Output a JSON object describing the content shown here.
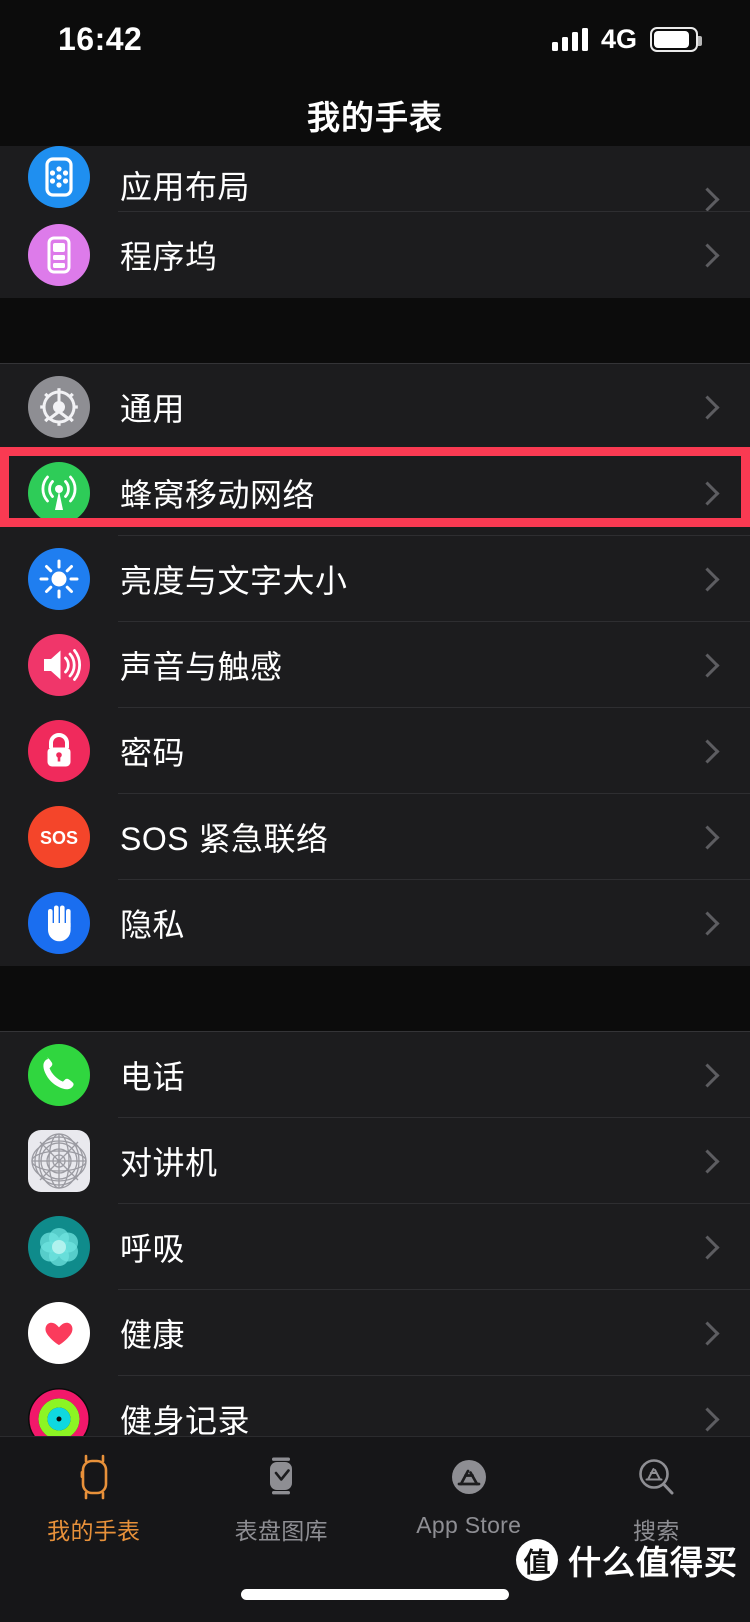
{
  "status_bar": {
    "time": "16:42",
    "network": "4G",
    "signal_bars": 4,
    "battery_level": "88%"
  },
  "nav": {
    "title": "我的手表"
  },
  "sections": [
    {
      "id": "section-apps",
      "rows": [
        {
          "label": "应用布局",
          "icon": "app-layout-icon",
          "color": "#1f8ff0",
          "clipped": true
        },
        {
          "label": "程序坞",
          "icon": "dock-icon",
          "color": "#dd7bea"
        }
      ]
    },
    {
      "id": "section-system",
      "rows": [
        {
          "label": "通用",
          "icon": "gear-icon",
          "color": "#8e8e93"
        },
        {
          "label": "蜂窝移动网络",
          "icon": "cellular-icon",
          "color": "#2ecc58",
          "highlighted": true
        },
        {
          "label": "亮度与文字大小",
          "icon": "brightness-icon",
          "color": "#1f7ef0"
        },
        {
          "label": "声音与触感",
          "icon": "sound-icon",
          "color": "#f0366a"
        },
        {
          "label": "密码",
          "icon": "lock-icon",
          "color": "#f02a5c"
        },
        {
          "label": "SOS 紧急联络",
          "icon": "sos-icon",
          "color": "#f4452a"
        },
        {
          "label": "隐私",
          "icon": "privacy-hand-icon",
          "color": "#1a6ef0"
        }
      ]
    },
    {
      "id": "section-apps2",
      "rows": [
        {
          "label": "电话",
          "icon": "phone-icon",
          "color": "#30d63f"
        },
        {
          "label": "对讲机",
          "icon": "walkie-talkie-icon",
          "color": "#e9e9ee"
        },
        {
          "label": "呼吸",
          "icon": "breathe-icon",
          "color": "#2ec6c6"
        },
        {
          "label": "健康",
          "icon": "health-heart-icon",
          "color": "#ffffff"
        },
        {
          "label": "健身记录",
          "icon": "activity-rings-icon",
          "color": "#f2186a"
        }
      ]
    }
  ],
  "tabbar": {
    "items": [
      {
        "label": "我的手表",
        "icon": "watch-icon",
        "active": true
      },
      {
        "label": "表盘图库",
        "icon": "face-gallery-icon",
        "active": false
      },
      {
        "label": "App Store",
        "icon": "appstore-icon",
        "active": false
      },
      {
        "label": "搜索",
        "icon": "search-appstore-icon",
        "active": false
      }
    ]
  },
  "annotation": {
    "highlight_color": "#f93a52",
    "target_row": "蜂窝移动网络"
  },
  "watermark": {
    "badge": "值",
    "text": "什么值得买"
  }
}
